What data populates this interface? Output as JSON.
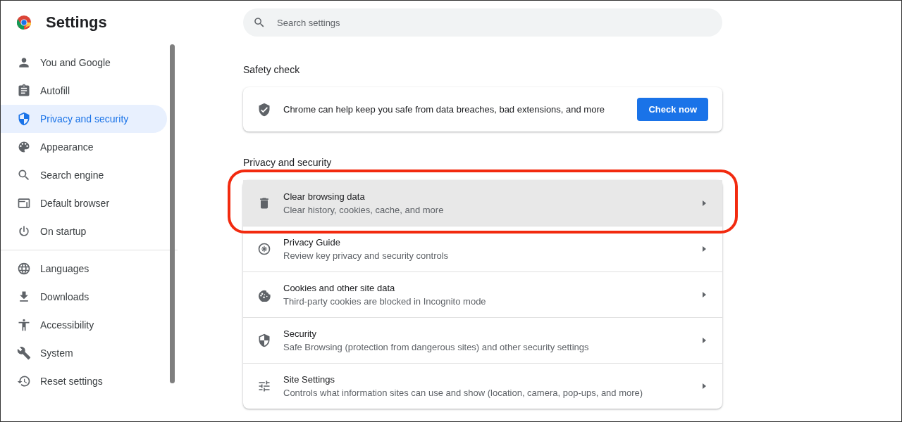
{
  "header": {
    "title": "Settings"
  },
  "search": {
    "placeholder": "Search settings"
  },
  "sidebar": {
    "sections": [
      {
        "items": [
          {
            "label": "You and Google",
            "selected": false
          },
          {
            "label": "Autofill",
            "selected": false
          },
          {
            "label": "Privacy and security",
            "selected": true
          },
          {
            "label": "Appearance",
            "selected": false
          },
          {
            "label": "Search engine",
            "selected": false
          },
          {
            "label": "Default browser",
            "selected": false
          },
          {
            "label": "On startup",
            "selected": false
          }
        ]
      },
      {
        "items": [
          {
            "label": "Languages",
            "selected": false
          },
          {
            "label": "Downloads",
            "selected": false
          },
          {
            "label": "Accessibility",
            "selected": false
          },
          {
            "label": "System",
            "selected": false
          },
          {
            "label": "Reset settings",
            "selected": false
          }
        ]
      }
    ]
  },
  "safety_check": {
    "title": "Safety check",
    "text": "Chrome can help keep you safe from data breaches, bad extensions, and more",
    "button": "Check now"
  },
  "privacy": {
    "title": "Privacy and security",
    "items": [
      {
        "title": "Clear browsing data",
        "subtitle": "Clear history, cookies, cache, and more",
        "hovered": true,
        "circled": true
      },
      {
        "title": "Privacy Guide",
        "subtitle": "Review key privacy and security controls",
        "hovered": false,
        "circled": false
      },
      {
        "title": "Cookies and other site data",
        "subtitle": "Third-party cookies are blocked in Incognito mode",
        "hovered": false,
        "circled": false
      },
      {
        "title": "Security",
        "subtitle": "Safe Browsing (protection from dangerous sites) and other security settings",
        "hovered": false,
        "circled": false
      },
      {
        "title": "Site Settings",
        "subtitle": "Controls what information sites can use and show (location, camera, pop-ups, and more)",
        "hovered": false,
        "circled": false
      }
    ]
  }
}
